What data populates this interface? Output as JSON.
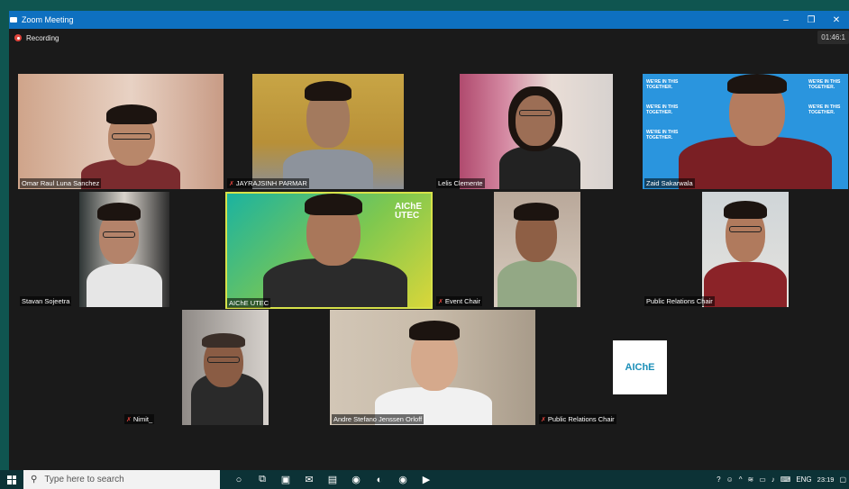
{
  "window": {
    "title": "Zoom Meeting",
    "recording_label": "Recording",
    "timer": "01:46:1",
    "controls": [
      "–",
      "❐",
      "✕"
    ]
  },
  "participants": [
    {
      "name": "Omar Raul Luna Sanchez",
      "muted": false
    },
    {
      "name": "JAYRAJSINH PARMAR",
      "muted": true
    },
    {
      "name": "Lelis Clemente",
      "muted": false
    },
    {
      "name": "Zaid Sakarwala",
      "muted": false
    },
    {
      "name": "Stavan Sojeetra",
      "muted": false
    },
    {
      "name": "AIChE UTEC",
      "muted": false,
      "active": true
    },
    {
      "name": "Event Chair",
      "muted": true
    },
    {
      "name": "Public Relations Chair",
      "muted": false
    },
    {
      "name": "Nimit_",
      "muted": true
    },
    {
      "name": "Andre Stefano Jenssen Orloff",
      "muted": false
    },
    {
      "name": "Public Relations Chair",
      "muted": true
    }
  ],
  "backgrounds": {
    "together_text": "WE'RE IN THIS TOGETHER.",
    "aiche_logo": "AIChE",
    "aiche_sub": "UTEC"
  },
  "taskbar": {
    "search_placeholder": "Type here to search",
    "language": "ENG",
    "time": "23:19"
  },
  "colors": {
    "titlebar": "#0e70c0",
    "active_speaker": "#d7e24a",
    "taskbar": "#0c3236"
  }
}
